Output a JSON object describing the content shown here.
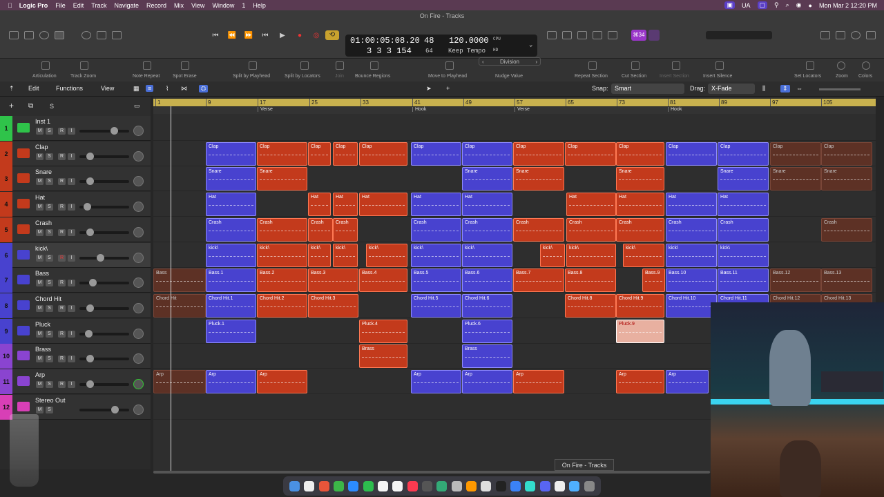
{
  "menubar": {
    "app": "Logic Pro",
    "items": [
      "File",
      "Edit",
      "Track",
      "Navigate",
      "Record",
      "Mix",
      "View",
      "Window",
      "1",
      "Help"
    ],
    "ua": "UA",
    "clock": "Mon Mar 2  12:20 PM"
  },
  "window": {
    "title": "On Fire - Tracks"
  },
  "lcd": {
    "time": "01:00:05:08.20",
    "bar": "48",
    "tempo": "120.0000",
    "position": "3  3  3  154",
    "bottom_num": "64",
    "tempo_mode": "Keep Tempo",
    "cpu": "CPU",
    "hd": "HD"
  },
  "key_badge": "⌘34",
  "tools": [
    "Articulation",
    "Track Zoom",
    "Note Repeat",
    "Spot Erase",
    "Split by Playhead",
    "Split by Locators",
    "Join",
    "Bounce Regions",
    "Move to Playhead",
    "Nudge Value",
    "Repeat Section",
    "Cut Section",
    "Insert Section",
    "Insert Silence",
    "Set Locators",
    "Zoom",
    "Colors"
  ],
  "division": "Division",
  "editbar": {
    "edit": "Edit",
    "functions": "Functions",
    "view": "View",
    "snap_label": "Snap:",
    "snap": "Smart",
    "drag_label": "Drag:",
    "drag": "X-Fade"
  },
  "ruler": [
    "1",
    "9",
    "17",
    "25",
    "33",
    "41",
    "49",
    "57",
    "65",
    "73",
    "81",
    "89",
    "97",
    "105"
  ],
  "markers": [
    "Verse",
    "Hook",
    "Verse",
    "Hook"
  ],
  "tracks": [
    {
      "num": "1",
      "name": "Inst 1",
      "color": "#2fc34a"
    },
    {
      "num": "2",
      "name": "Clap",
      "color": "#c33a1c"
    },
    {
      "num": "3",
      "name": "Snare",
      "color": "#c33a1c"
    },
    {
      "num": "4",
      "name": "Hat",
      "color": "#c33a1c"
    },
    {
      "num": "5",
      "name": "Crash",
      "color": "#c33a1c"
    },
    {
      "num": "6",
      "name": "kick\\",
      "color": "#4842cf"
    },
    {
      "num": "7",
      "name": "Bass",
      "color": "#4842cf"
    },
    {
      "num": "8",
      "name": "Chord Hit",
      "color": "#4842cf"
    },
    {
      "num": "9",
      "name": "Pluck",
      "color": "#4842cf"
    },
    {
      "num": "10",
      "name": "Brass",
      "color": "#8a44d0"
    },
    {
      "num": "11",
      "name": "Arp",
      "color": "#8a44d0"
    },
    {
      "num": "12",
      "name": "Stereo Out",
      "color": "#d83fb6"
    }
  ],
  "btn": {
    "m": "M",
    "s": "S",
    "r": "R",
    "i": "I"
  },
  "regions": {
    "clap": [
      "Clap",
      "Clap",
      "Clap",
      "Clap",
      "Clap",
      "Clap",
      "Clap",
      "Clap",
      "Clap",
      "Clap",
      "Clap",
      "Clap",
      "Clap",
      "Clap"
    ],
    "snare": [
      "Snare",
      "Snare",
      "Snare",
      "Snare",
      "Snare",
      "Snare",
      "Snare",
      "Snare"
    ],
    "hat": [
      "Hat",
      "Hat",
      "Hat",
      "Hat",
      "Hat",
      "Hat",
      "Hat",
      "Hat",
      "Hat",
      "Hat"
    ],
    "crash": [
      "Crash",
      "Crash",
      "Crash",
      "Crash",
      "Crash",
      "Crash",
      "Crash",
      "Crash",
      "Crash",
      "Crash",
      "Crash",
      "Crash"
    ],
    "kick": [
      "kick\\",
      "kick\\",
      "kick\\",
      "kick\\",
      "kick\\",
      "kick\\",
      "kick\\",
      "kick\\",
      "kick\\",
      "kick\\",
      "kick\\",
      "kick\\"
    ],
    "bass": [
      "Bass",
      "Bass.1",
      "Bass.2",
      "Bass.3",
      "Bass.4",
      "Bass.5",
      "Bass.6",
      "Bass.7",
      "Bass.8",
      "Bass.9",
      "Bass.10",
      "Bass.11",
      "Bass.12",
      "Bass.13"
    ],
    "chord": [
      "Chord Hit",
      "Chord Hit.1",
      "Chord Hit.2",
      "Chord Hit.3",
      "Chord Hit.5",
      "Chord Hit.6",
      "Chord Hit.8",
      "Chord Hit.9",
      "Chord Hit.10",
      "Chord Hit.11",
      "Chord Hit.12",
      "Chord Hit.13"
    ],
    "pluck": [
      "Pluck.1",
      "Pluck.4",
      "Pluck.6",
      "Pluck.9"
    ],
    "brass": [
      "Brass",
      "Brass"
    ],
    "arp": [
      "Arp",
      "Arp",
      "Arp",
      "Arp",
      "Arp",
      "Arp",
      "Arp",
      "Arp"
    ]
  },
  "tooltip": "On Fire - Tracks",
  "colors": {
    "red": "#c33a1c",
    "blue": "#4842cf",
    "ruler": "#c8b14e",
    "menubar": "#5a3a52"
  }
}
